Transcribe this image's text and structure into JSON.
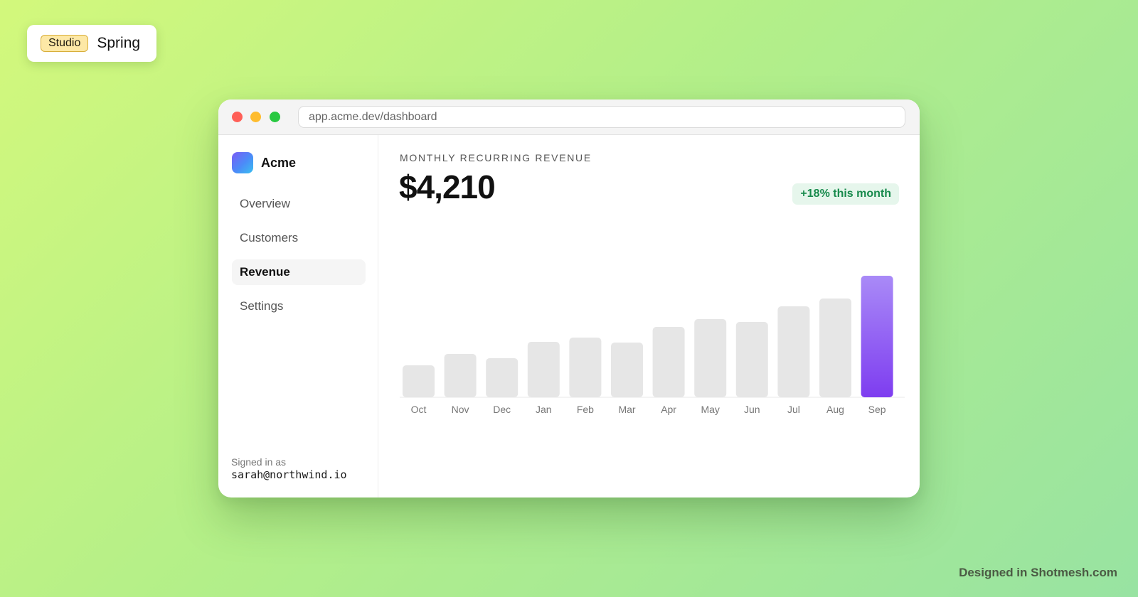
{
  "badge": {
    "studio_label": "Studio",
    "theme_label": "Spring"
  },
  "browser": {
    "url": "app.acme.dev/dashboard"
  },
  "sidebar": {
    "brand": "Acme",
    "items": [
      {
        "label": "Overview",
        "active": false
      },
      {
        "label": "Customers",
        "active": false
      },
      {
        "label": "Revenue",
        "active": true
      },
      {
        "label": "Settings",
        "active": false
      }
    ],
    "signed_in_label": "Signed in as",
    "signed_in_email": "sarah@northwind.io"
  },
  "main": {
    "metric_label": "MONTHLY RECURRING REVENUE",
    "metric_value": "$4,210",
    "change_badge": "+18% this month"
  },
  "chart_data": {
    "type": "bar",
    "categories": [
      "Oct",
      "Nov",
      "Dec",
      "Jan",
      "Feb",
      "Mar",
      "Apr",
      "May",
      "Jun",
      "Jul",
      "Aug",
      "Sep"
    ],
    "values": [
      45,
      61,
      55,
      78,
      84,
      77,
      99,
      110,
      106,
      128,
      139,
      171
    ],
    "highlight_index": 11,
    "bar_color": "#e6e6e6",
    "highlight_color_top": "#a98af7",
    "highlight_color_bottom": "#7e3df0",
    "grid": false,
    "title": "",
    "xlabel": "",
    "ylabel": ""
  },
  "footer": {
    "watermark": "Designed in Shotmesh.com"
  }
}
